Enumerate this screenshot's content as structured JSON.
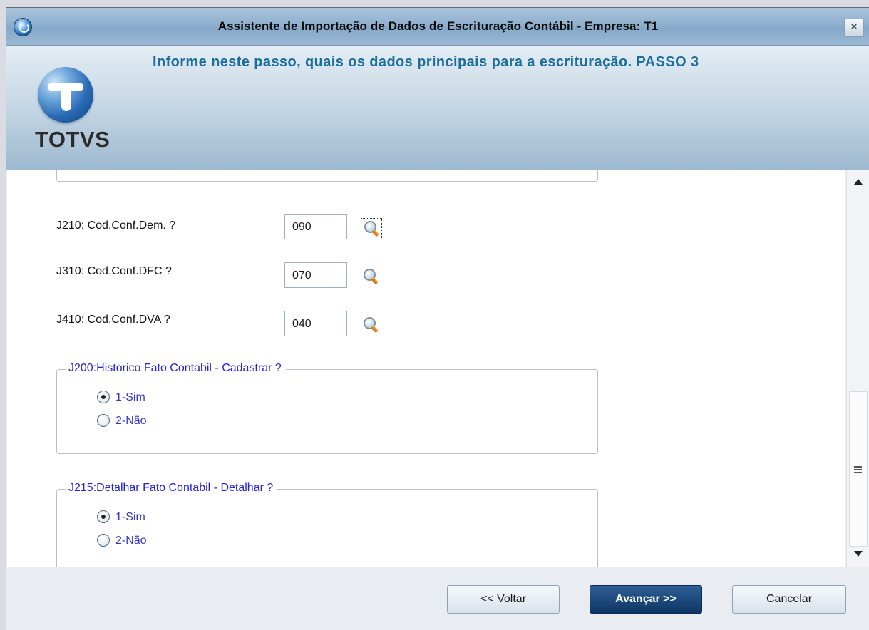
{
  "window": {
    "title": "Assistente de Importação de Dados de Escrituração Contábil - Empresa: T1",
    "close_label": "×"
  },
  "banner": {
    "logo_text": "TOTVS",
    "instruction": "Informe neste passo, quais os dados principais para a escrituração. PASSO 3"
  },
  "fields": [
    {
      "label": "J210: Cod.Conf.Dem.  ?",
      "value": "090"
    },
    {
      "label": "J310: Cod.Conf.DFC ?",
      "value": "070"
    },
    {
      "label": "J410: Cod.Conf.DVA ?",
      "value": "040"
    }
  ],
  "groups": [
    {
      "legend": "J200:Historico Fato Contabil - Cadastrar ?",
      "options": [
        "1-Sim",
        "2-Não"
      ],
      "selected": "1-Sim"
    },
    {
      "legend": "J215:Detalhar Fato Contabil - Detalhar ?",
      "options": [
        "1-Sim",
        "2-Não"
      ],
      "selected": "1-Sim"
    }
  ],
  "buttons": {
    "back": "<< Voltar",
    "next": "Avançar >>",
    "cancel": "Cancelar"
  },
  "colors": {
    "instruction": "#1d6e9a",
    "group_text": "#2323d8",
    "primary_button": "#0e3664"
  }
}
